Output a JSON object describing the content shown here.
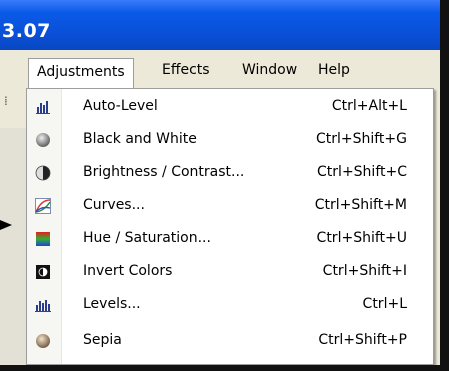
{
  "window": {
    "title": "3.07"
  },
  "menubar": {
    "items": [
      {
        "label": "Adjustments"
      },
      {
        "label": "Effects"
      },
      {
        "label": "Window"
      },
      {
        "label": "Help"
      }
    ],
    "active": "Adjustments"
  },
  "adjustments_menu": {
    "items": [
      {
        "label": "Auto-Level",
        "shortcut": "Ctrl+Alt+L",
        "icon": "auto-level-icon"
      },
      {
        "label": "Black and White",
        "shortcut": "Ctrl+Shift+G",
        "icon": "black-white-icon"
      },
      {
        "label": "Brightness / Contrast...",
        "shortcut": "Ctrl+Shift+C",
        "icon": "brightness-contrast-icon"
      },
      {
        "label": "Curves...",
        "shortcut": "Ctrl+Shift+M",
        "icon": "curves-icon"
      },
      {
        "label": "Hue / Saturation...",
        "shortcut": "Ctrl+Shift+U",
        "icon": "hue-saturation-icon"
      },
      {
        "label": "Invert Colors",
        "shortcut": "Ctrl+Shift+I",
        "icon": "invert-colors-icon"
      },
      {
        "label": "Levels...",
        "shortcut": "Ctrl+L",
        "icon": "levels-icon"
      },
      {
        "label": "Sepia",
        "shortcut": "Ctrl+Shift+P",
        "icon": "sepia-icon"
      }
    ]
  },
  "colors": {
    "titlebar": "#0a5ae8",
    "menubar": "#ece9d8",
    "menu_bg": "#ffffff"
  }
}
